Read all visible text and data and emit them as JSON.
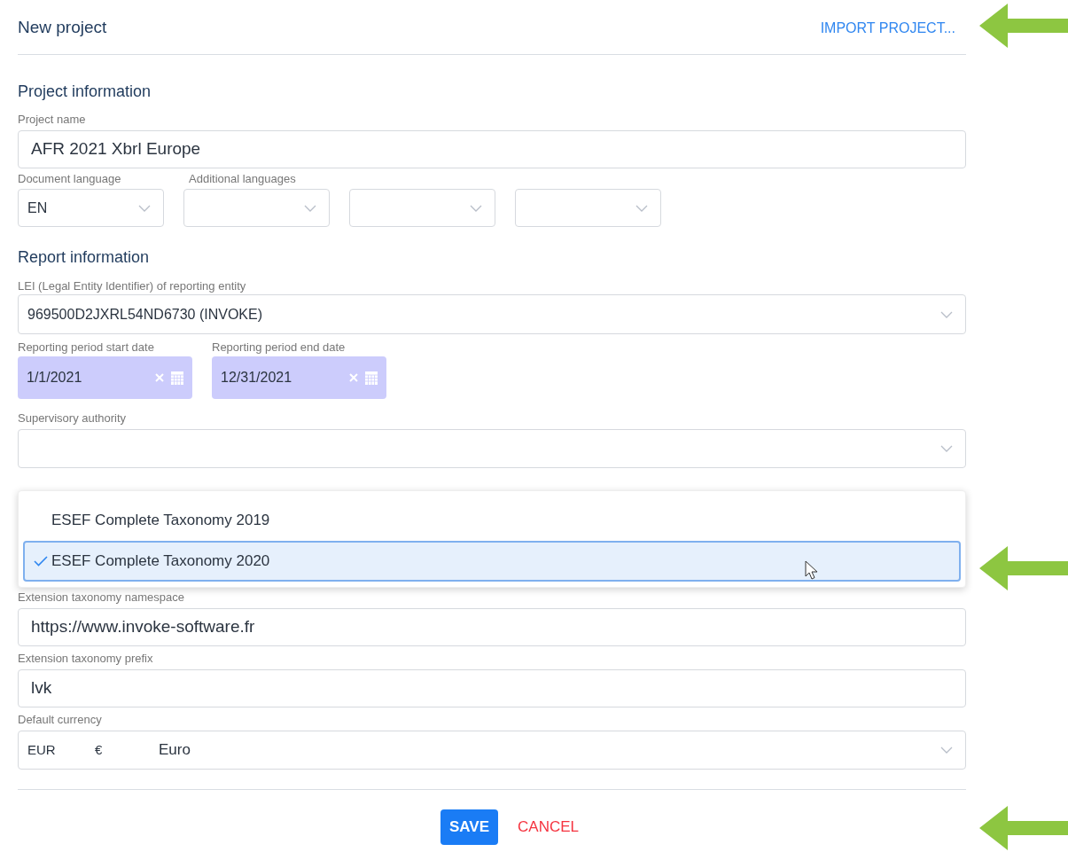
{
  "header": {
    "title": "New project",
    "import_link": "IMPORT PROJECT..."
  },
  "project_section": {
    "heading": "Project information",
    "project_name": {
      "label": "Project name",
      "value": "AFR 2021 Xbrl Europe"
    },
    "document_language": {
      "label": "Document language",
      "value": "EN"
    },
    "additional_languages": {
      "label": "Additional languages",
      "selects": [
        {
          "kind": "empty-select"
        },
        {
          "kind": "empty-select"
        },
        {
          "kind": "empty-select"
        }
      ]
    }
  },
  "report_section": {
    "heading": "Report information",
    "lei": {
      "label": "LEI (Legal Entity Identifier) of reporting entity",
      "value": "969500D2JXRL54ND6730 (INVOKE)"
    },
    "start_date": {
      "label": "Reporting period start date",
      "value": "1/1/2021"
    },
    "end_date": {
      "label": "Reporting period end date",
      "value": "12/31/2021"
    },
    "supervisory_authority": {
      "label": "Supervisory authority"
    }
  },
  "taxonomy_dropdown": [
    {
      "label": "ESEF Complete Taxonomy 2019",
      "selected": false
    },
    {
      "label": "ESEF Complete Taxonomy 2020",
      "selected": true
    }
  ],
  "extension_namespace": {
    "label": "Extension taxonomy namespace",
    "value": "https://www.invoke-software.fr"
  },
  "extension_prefix": {
    "label": "Extension taxonomy prefix",
    "value": "lvk"
  },
  "default_currency": {
    "label": "Default currency",
    "code": "EUR",
    "symbol": "€",
    "name": "Euro"
  },
  "buttons": {
    "save": "SAVE",
    "cancel": "CANCEL"
  }
}
